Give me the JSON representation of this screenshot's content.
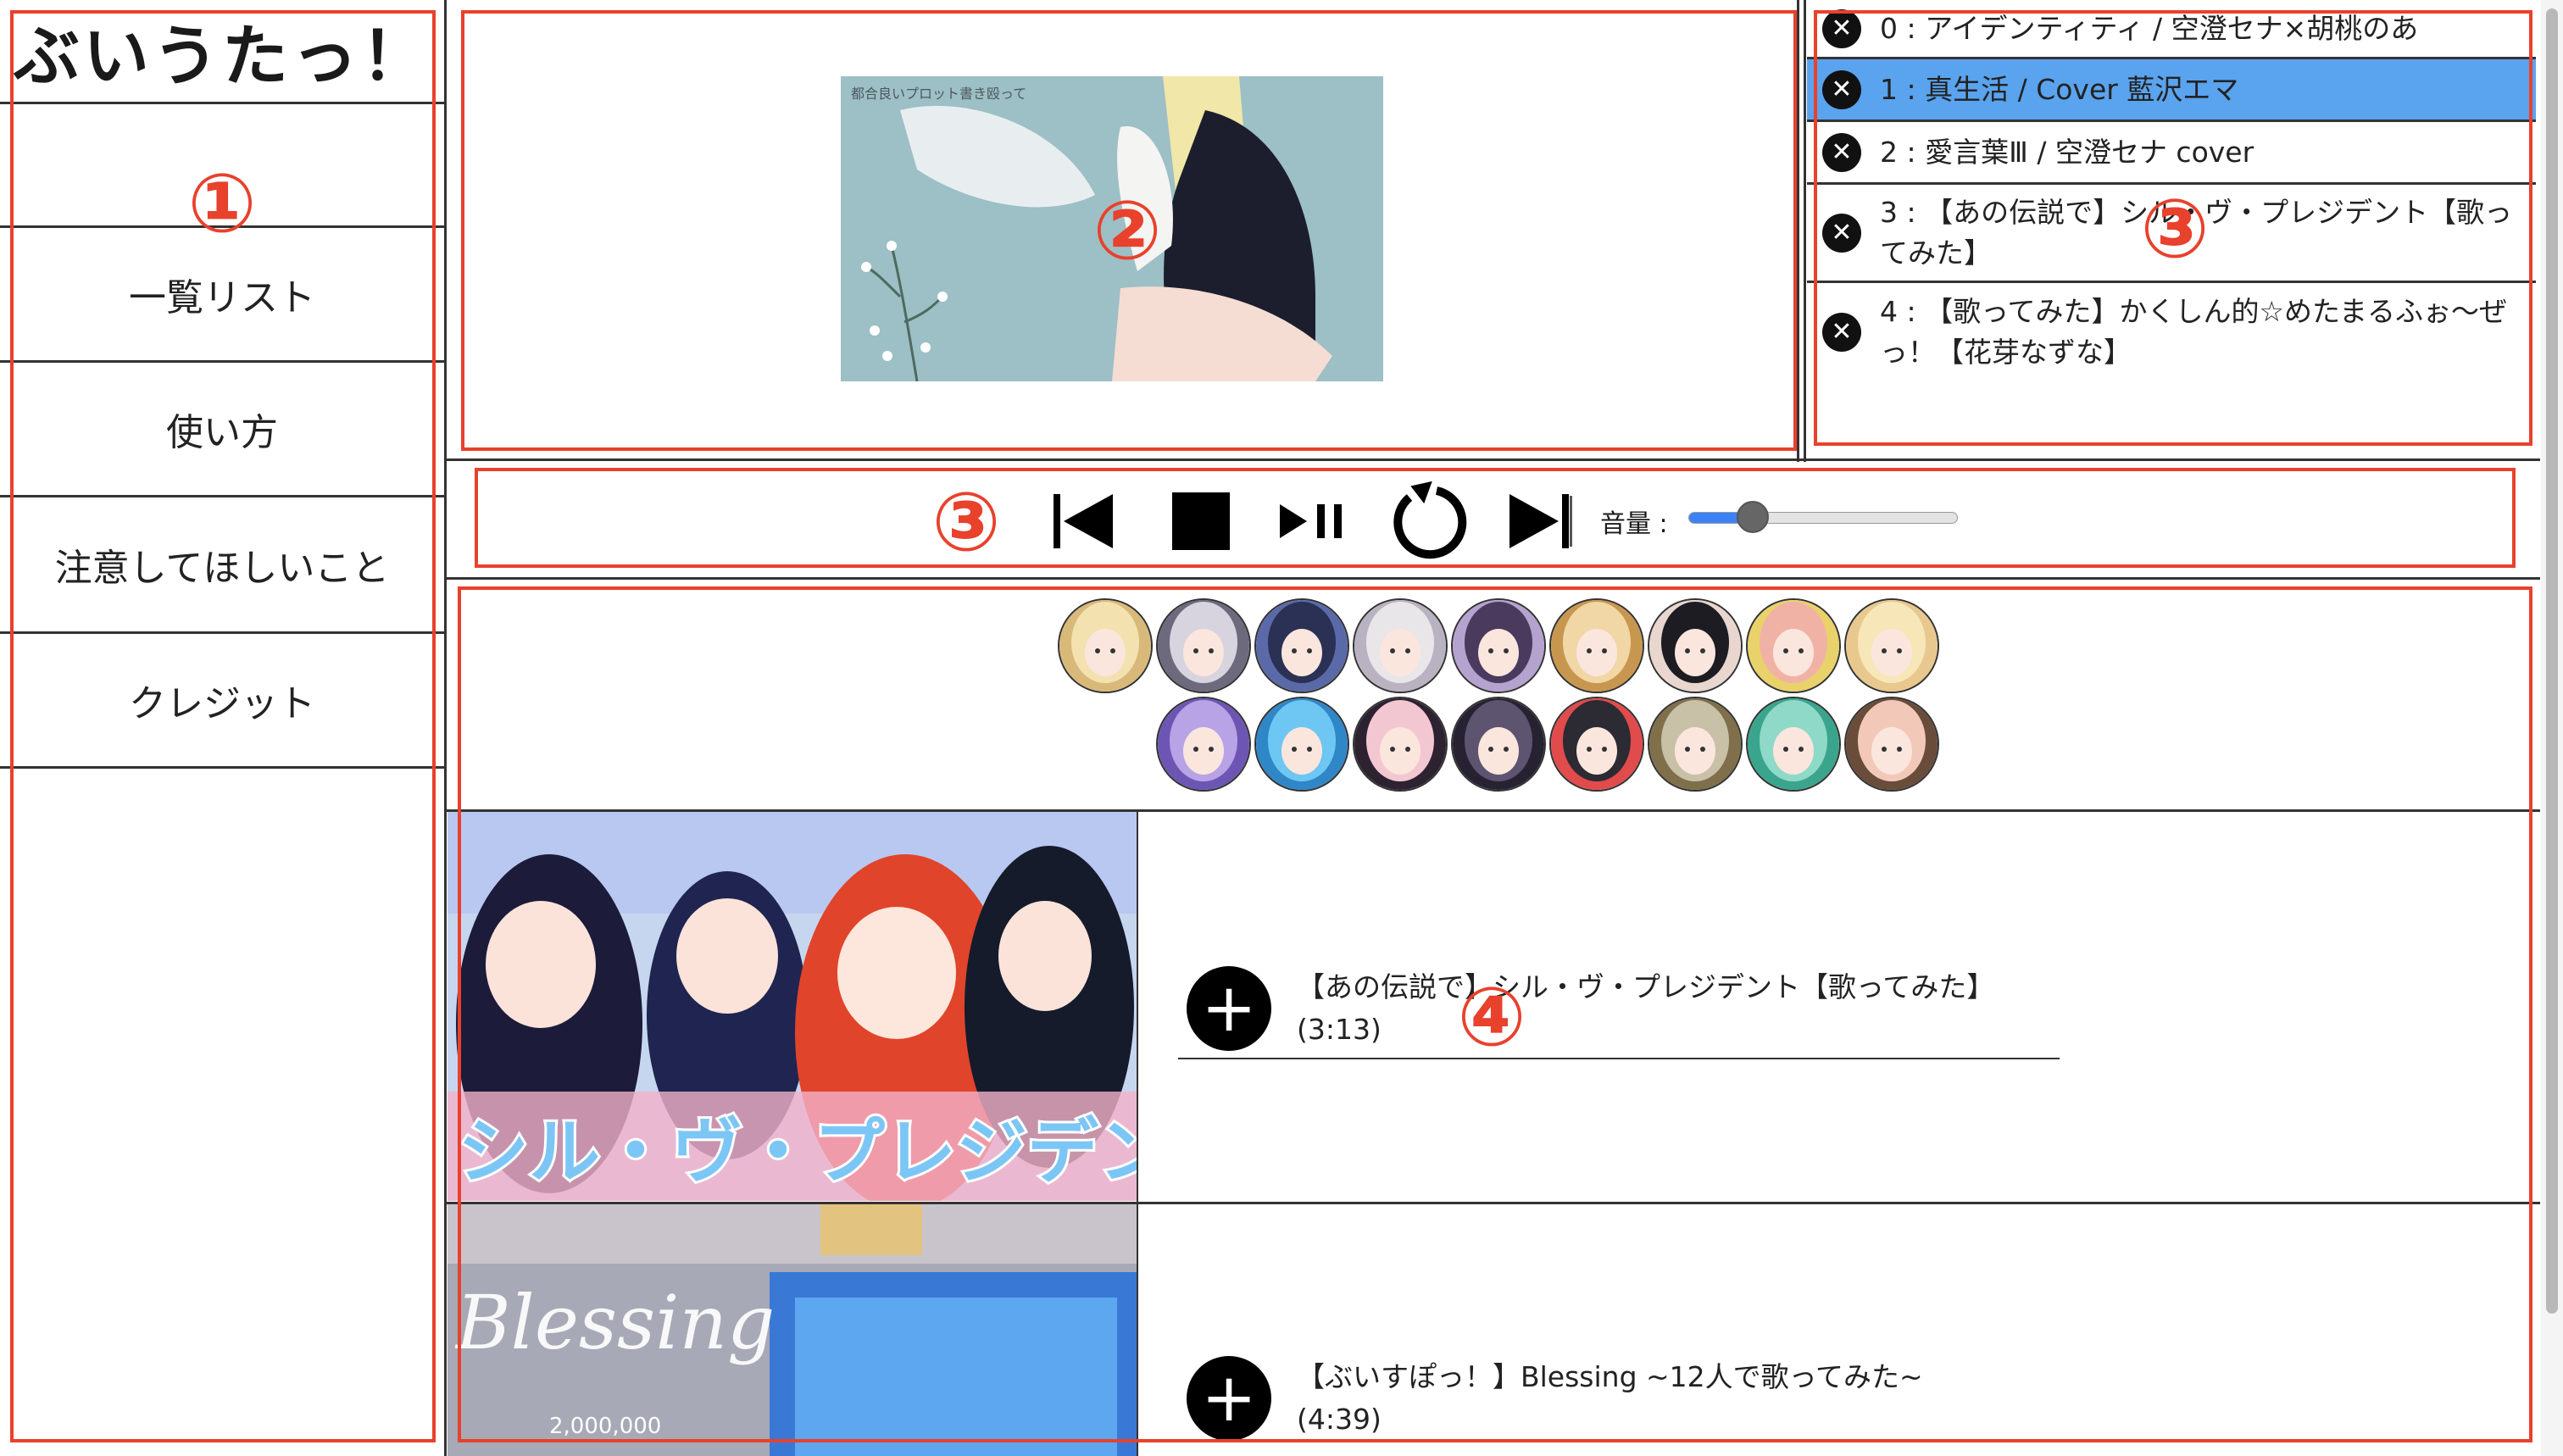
{
  "sidebar": {
    "logo": "ぶいうたっ！",
    "items": [
      {
        "label": "一覧リスト"
      },
      {
        "label": "使い方"
      },
      {
        "label": "注意してほしいこと"
      },
      {
        "label": "クレジット"
      }
    ]
  },
  "video": {
    "thumbnail_caption": "都合良いプロット書き殴って"
  },
  "playlist": {
    "items": [
      {
        "label": "0 : アイデンティティ / 空澄セナ×胡桃のあ",
        "active": false
      },
      {
        "label": "1 : 真生活 / Cover 藍沢エマ",
        "active": true
      },
      {
        "label": "2 : 愛言葉Ⅲ / 空澄セナ cover",
        "active": false
      },
      {
        "label": "3 : 【あの伝説で】シル・ヴ・プレジデント【歌ってみた】",
        "active": false
      },
      {
        "label": "4 : 【歌ってみた】かくしん的☆めたまるふぉ〜ぜっ！【花芽なずな】",
        "active": false
      }
    ],
    "remove_icon": "close-icon"
  },
  "controls": {
    "volume_label": "音量 :",
    "volume": 0.2,
    "icons": [
      "skip-previous-icon",
      "stop-icon",
      "play-pause-icon",
      "repeat-icon",
      "skip-next-icon"
    ]
  },
  "songs": [
    {
      "title": "【あの伝説で】シル・ヴ・プレジデント【歌ってみた】",
      "duration": "(3:13)",
      "thumb_text": "シル・ヴ・プレジデント"
    },
    {
      "title": "【ぶいすぽっ！】Blessing ~12人で歌ってみた~",
      "duration": "(4:39)",
      "thumb_text": "Blessing",
      "thumb_subtext": "2,000,000"
    }
  ],
  "annotations": [
    "①",
    "②",
    "③",
    "③",
    "④"
  ],
  "colors": {
    "annotation": "#e8412c",
    "active_row": "#5aa3ee"
  }
}
